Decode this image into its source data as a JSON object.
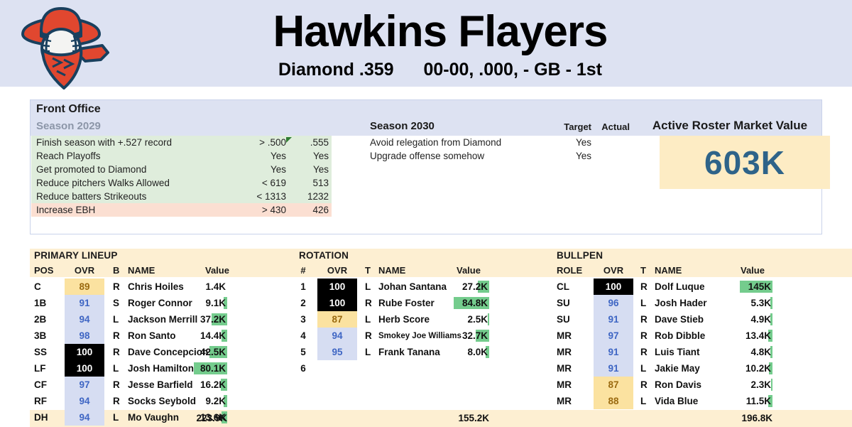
{
  "header": {
    "team_name": "Hawkins Flayers",
    "league": "Diamond .359",
    "record": "00-00, .000, - GB - 1st",
    "logo_name": "cowboy-bandit-baseball-logo",
    "colors": {
      "band": "#dde2f2",
      "logo_red": "#e1472f",
      "logo_navy": "#19405e"
    }
  },
  "front_office": {
    "title": "Front Office",
    "season_left_label": "Season 2029",
    "season_right_label": "Season 2030",
    "col_target": "Target",
    "col_actual": "Actual",
    "goals_2029": [
      {
        "label": "Finish season with +.527 record",
        "target": "> .500",
        "actual": ".555",
        "met": true,
        "flag": true
      },
      {
        "label": "Reach Playoffs",
        "target": "Yes",
        "actual": "Yes",
        "met": true,
        "flag": false
      },
      {
        "label": "Get promoted to Diamond",
        "target": "Yes",
        "actual": "Yes",
        "met": true,
        "flag": false
      },
      {
        "label": "Reduce pitchers Walks Allowed",
        "target": "< 619",
        "actual": "513",
        "met": true,
        "flag": false
      },
      {
        "label": "Reduce batters Strikeouts",
        "target": "< 1313",
        "actual": "1232",
        "met": true,
        "flag": false
      },
      {
        "label": "Increase EBH",
        "target": "> 430",
        "actual": "426",
        "met": false,
        "flag": false
      }
    ],
    "goals_2030": [
      {
        "label": "Avoid relegation from Diamond",
        "target": "Yes"
      },
      {
        "label": "Upgrade offense somehow",
        "target": "Yes"
      }
    ],
    "market_value": {
      "title": "Active Roster Market Value",
      "value": "603K"
    }
  },
  "roster": {
    "lineup": {
      "section_title": "PRIMARY LINEUP",
      "headers": {
        "pos": "POS",
        "ovr": "OVR",
        "hand": "B",
        "name": "NAME",
        "value": "Value"
      },
      "rows": [
        {
          "pos": "C",
          "ovr": "89",
          "tier": "t80",
          "hand": "R",
          "name": "Chris Hoiles",
          "value": "1.4K",
          "bar": 0
        },
        {
          "pos": "1B",
          "ovr": "91",
          "tier": "t90",
          "hand": "S",
          "name": "Roger Connor",
          "value": "9.1K",
          "bar": 5
        },
        {
          "pos": "2B",
          "ovr": "94",
          "tier": "t90",
          "hand": "L",
          "name": "Jackson Merrill",
          "value": "37.2K",
          "bar": 22
        },
        {
          "pos": "3B",
          "ovr": "98",
          "tier": "t90",
          "hand": "R",
          "name": "Ron Santo",
          "value": "14.4K",
          "bar": 8
        },
        {
          "pos": "SS",
          "ovr": "100",
          "tier": "t100",
          "hand": "R",
          "name": "Dave Concepcion",
          "value": "42.5K",
          "bar": 25
        },
        {
          "pos": "LF",
          "ovr": "100",
          "tier": "t100",
          "hand": "L",
          "name": "Josh Hamilton",
          "value": "80.1K",
          "bar": 47
        },
        {
          "pos": "CF",
          "ovr": "97",
          "tier": "t90",
          "hand": "R",
          "name": "Jesse Barfield",
          "value": "16.2K",
          "bar": 9
        },
        {
          "pos": "RF",
          "ovr": "94",
          "tier": "t90",
          "hand": "R",
          "name": "Socks Seybold",
          "value": "9.2K",
          "bar": 5
        },
        {
          "pos": "DH",
          "ovr": "94",
          "tier": "t90",
          "hand": "L",
          "name": "Mo Vaughn",
          "value": "13.6K",
          "bar": 8
        }
      ],
      "total": "223.9K"
    },
    "rotation": {
      "section_title": "ROTATION",
      "headers": {
        "num": "#",
        "ovr": "OVR",
        "hand": "T",
        "name": "NAME",
        "value": "Value"
      },
      "rows": [
        {
          "num": "1",
          "ovr": "100",
          "tier": "t100",
          "hand": "L",
          "name": "Johan Santana",
          "value": "27.2K",
          "bar": 16,
          "small": false
        },
        {
          "num": "2",
          "ovr": "100",
          "tier": "t100",
          "hand": "R",
          "name": "Rube Foster",
          "value": "84.8K",
          "bar": 50,
          "small": false
        },
        {
          "num": "3",
          "ovr": "87",
          "tier": "t80",
          "hand": "L",
          "name": "Herb Score",
          "value": "2.5K",
          "bar": 2,
          "small": false
        },
        {
          "num": "4",
          "ovr": "94",
          "tier": "t90",
          "hand": "R",
          "name": "Smokey Joe Williams",
          "value": "32.7K",
          "bar": 19,
          "small": true
        },
        {
          "num": "5",
          "ovr": "95",
          "tier": "t90",
          "hand": "L",
          "name": "Frank Tanana",
          "value": "8.0K",
          "bar": 5,
          "small": false
        },
        {
          "num": "6",
          "ovr": "",
          "tier": "tnone",
          "hand": "",
          "name": "",
          "value": "",
          "bar": 0,
          "small": false
        }
      ],
      "total": "155.2K"
    },
    "bullpen": {
      "section_title": "BULLPEN",
      "headers": {
        "role": "ROLE",
        "ovr": "OVR",
        "hand": "T",
        "name": "NAME",
        "value": "Value"
      },
      "rows": [
        {
          "role": "CL",
          "ovr": "100",
          "tier": "t100",
          "hand": "R",
          "name": "Dolf Luque",
          "value": "145K",
          "bar": 46
        },
        {
          "role": "SU",
          "ovr": "96",
          "tier": "t90",
          "hand": "L",
          "name": "Josh Hader",
          "value": "5.3K",
          "bar": 3
        },
        {
          "role": "SU",
          "ovr": "91",
          "tier": "t90",
          "hand": "R",
          "name": "Dave Stieb",
          "value": "4.9K",
          "bar": 3
        },
        {
          "role": "MR",
          "ovr": "97",
          "tier": "t90",
          "hand": "R",
          "name": "Rob Dibble",
          "value": "13.4K",
          "bar": 6
        },
        {
          "role": "MR",
          "ovr": "91",
          "tier": "t90",
          "hand": "R",
          "name": "Luis Tiant",
          "value": "4.8K",
          "bar": 3
        },
        {
          "role": "MR",
          "ovr": "91",
          "tier": "t90",
          "hand": "L",
          "name": "Jakie May",
          "value": "10.2K",
          "bar": 5
        },
        {
          "role": "MR",
          "ovr": "87",
          "tier": "t80",
          "hand": "R",
          "name": "Ron Davis",
          "value": "2.3K",
          "bar": 2
        },
        {
          "role": "MR",
          "ovr": "88",
          "tier": "t80",
          "hand": "L",
          "name": "Vida Blue",
          "value": "11.5K",
          "bar": 6
        }
      ],
      "total": "196.8K"
    }
  }
}
